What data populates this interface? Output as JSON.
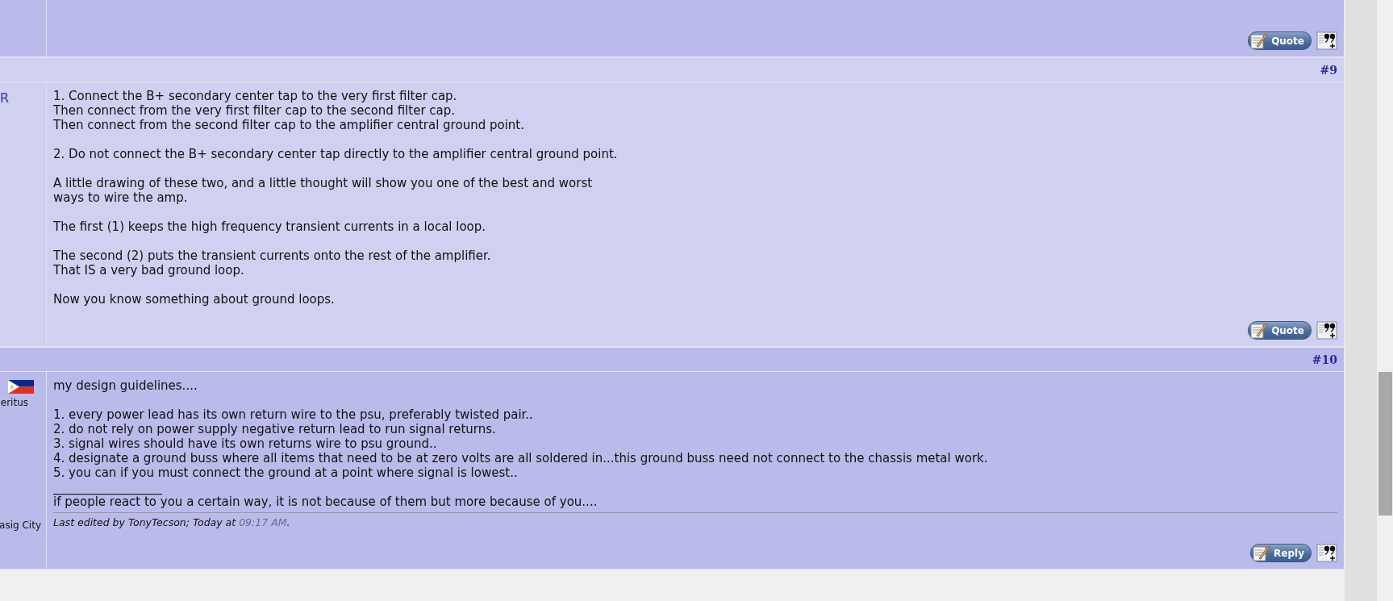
{
  "posts": [
    {
      "buttons": [
        {
          "label": "Quote"
        }
      ]
    },
    {
      "number": "#9",
      "author_panel": [
        {
          "kind": "name",
          "text": "R"
        }
      ],
      "paragraphs": [
        "1. Connect the B+ secondary center tap to the very first filter cap.\nThen connect from the very first filter cap to the second filter cap.\nThen connect from the second filter cap to the amplifier central ground point.",
        "2. Do not connect the B+ secondary center tap directly to the amplifier central ground point.",
        "A little drawing of these two, and a little thought will show you one of the best and worst\nways to wire the amp.",
        "The first (1) keeps the high frequency transient currents in a local loop.",
        "The second (2) puts the transient currents onto the rest of the amplifier.\nThat IS a very bad ground loop.",
        "Now you know something about ground loops."
      ],
      "buttons": [
        {
          "label": "Quote"
        }
      ]
    },
    {
      "number": "#10",
      "author_panel": [
        {
          "kind": "flag"
        },
        {
          "kind": "status",
          "text": "eritus"
        },
        {
          "kind": "location",
          "text": "asig City"
        }
      ],
      "paragraphs": [
        "my design guidelines....",
        "1. every power lead has its own return wire to the psu, preferably twisted pair..\n2. do not rely on power supply negative return lead to run signal returns.\n3. signal wires should have its own returns wire to psu ground..\n4. designate a ground buss where all items that need to be at zero volts are all soldered in...this ground buss need not connect to the chassis metal work.\n5. you can if you must connect the ground at a point where signal is lowest.."
      ],
      "signature": {
        "rule": "__________________",
        "text": "if people react to you a certain way, it is not because of them but more because of you...."
      },
      "edit_note": {
        "text": "Last edited by TonyTecson; Today at ",
        "time": "09:17 AM",
        "end": "."
      },
      "buttons": [
        {
          "label": "Reply"
        }
      ]
    }
  ]
}
